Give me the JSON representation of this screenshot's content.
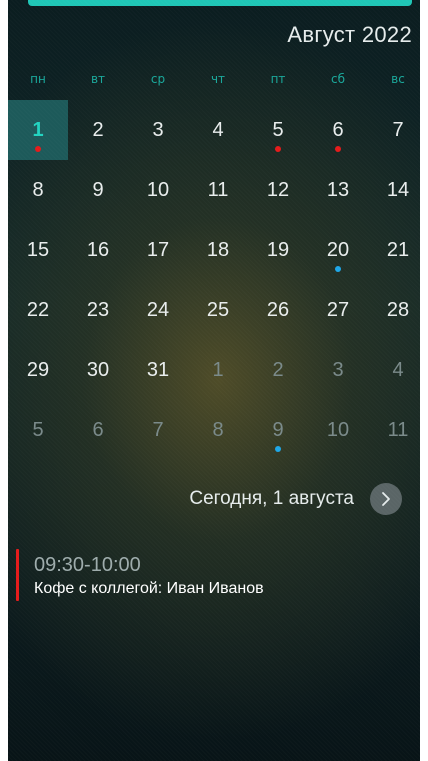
{
  "header": {
    "month_year": "Август 2022"
  },
  "weekdays": [
    "пн",
    "вт",
    "ср",
    "чт",
    "пт",
    "сб",
    "вс"
  ],
  "calendar": {
    "weeks": [
      [
        {
          "label": "1",
          "current_month": true,
          "today": true,
          "dot": "red"
        },
        {
          "label": "2",
          "current_month": true
        },
        {
          "label": "3",
          "current_month": true
        },
        {
          "label": "4",
          "current_month": true
        },
        {
          "label": "5",
          "current_month": true,
          "dot": "red"
        },
        {
          "label": "6",
          "current_month": true,
          "dot": "red"
        },
        {
          "label": "7",
          "current_month": true
        }
      ],
      [
        {
          "label": "8",
          "current_month": true
        },
        {
          "label": "9",
          "current_month": true
        },
        {
          "label": "10",
          "current_month": true
        },
        {
          "label": "11",
          "current_month": true
        },
        {
          "label": "12",
          "current_month": true
        },
        {
          "label": "13",
          "current_month": true
        },
        {
          "label": "14",
          "current_month": true
        }
      ],
      [
        {
          "label": "15",
          "current_month": true
        },
        {
          "label": "16",
          "current_month": true
        },
        {
          "label": "17",
          "current_month": true
        },
        {
          "label": "18",
          "current_month": true
        },
        {
          "label": "19",
          "current_month": true
        },
        {
          "label": "20",
          "current_month": true,
          "dot": "blue"
        },
        {
          "label": "21",
          "current_month": true
        }
      ],
      [
        {
          "label": "22",
          "current_month": true
        },
        {
          "label": "23",
          "current_month": true
        },
        {
          "label": "24",
          "current_month": true
        },
        {
          "label": "25",
          "current_month": true
        },
        {
          "label": "26",
          "current_month": true
        },
        {
          "label": "27",
          "current_month": true
        },
        {
          "label": "28",
          "current_month": true
        }
      ],
      [
        {
          "label": "29",
          "current_month": true
        },
        {
          "label": "30",
          "current_month": true
        },
        {
          "label": "31",
          "current_month": true
        },
        {
          "label": "1",
          "current_month": false
        },
        {
          "label": "2",
          "current_month": false
        },
        {
          "label": "3",
          "current_month": false
        },
        {
          "label": "4",
          "current_month": false
        }
      ],
      [
        {
          "label": "5",
          "current_month": false
        },
        {
          "label": "6",
          "current_month": false
        },
        {
          "label": "7",
          "current_month": false
        },
        {
          "label": "8",
          "current_month": false
        },
        {
          "label": "9",
          "current_month": false,
          "dot": "blue"
        },
        {
          "label": "10",
          "current_month": false
        },
        {
          "label": "11",
          "current_month": false
        }
      ]
    ]
  },
  "today_label": "Сегодня, 1 августа",
  "next_day_icon": "chevron-right-icon",
  "events": [
    {
      "time": "09:30-10:00",
      "title": "Кофе с коллегой: Иван Иванов",
      "color": "#e51b1b"
    }
  ],
  "colors": {
    "accent": "#1fc6b6",
    "weekday": "#1aa89b",
    "today_bg": "#1d5a5a",
    "today_text": "#22d3c0",
    "dot_red": "#e51b1b",
    "dot_blue": "#1ea7e8"
  }
}
